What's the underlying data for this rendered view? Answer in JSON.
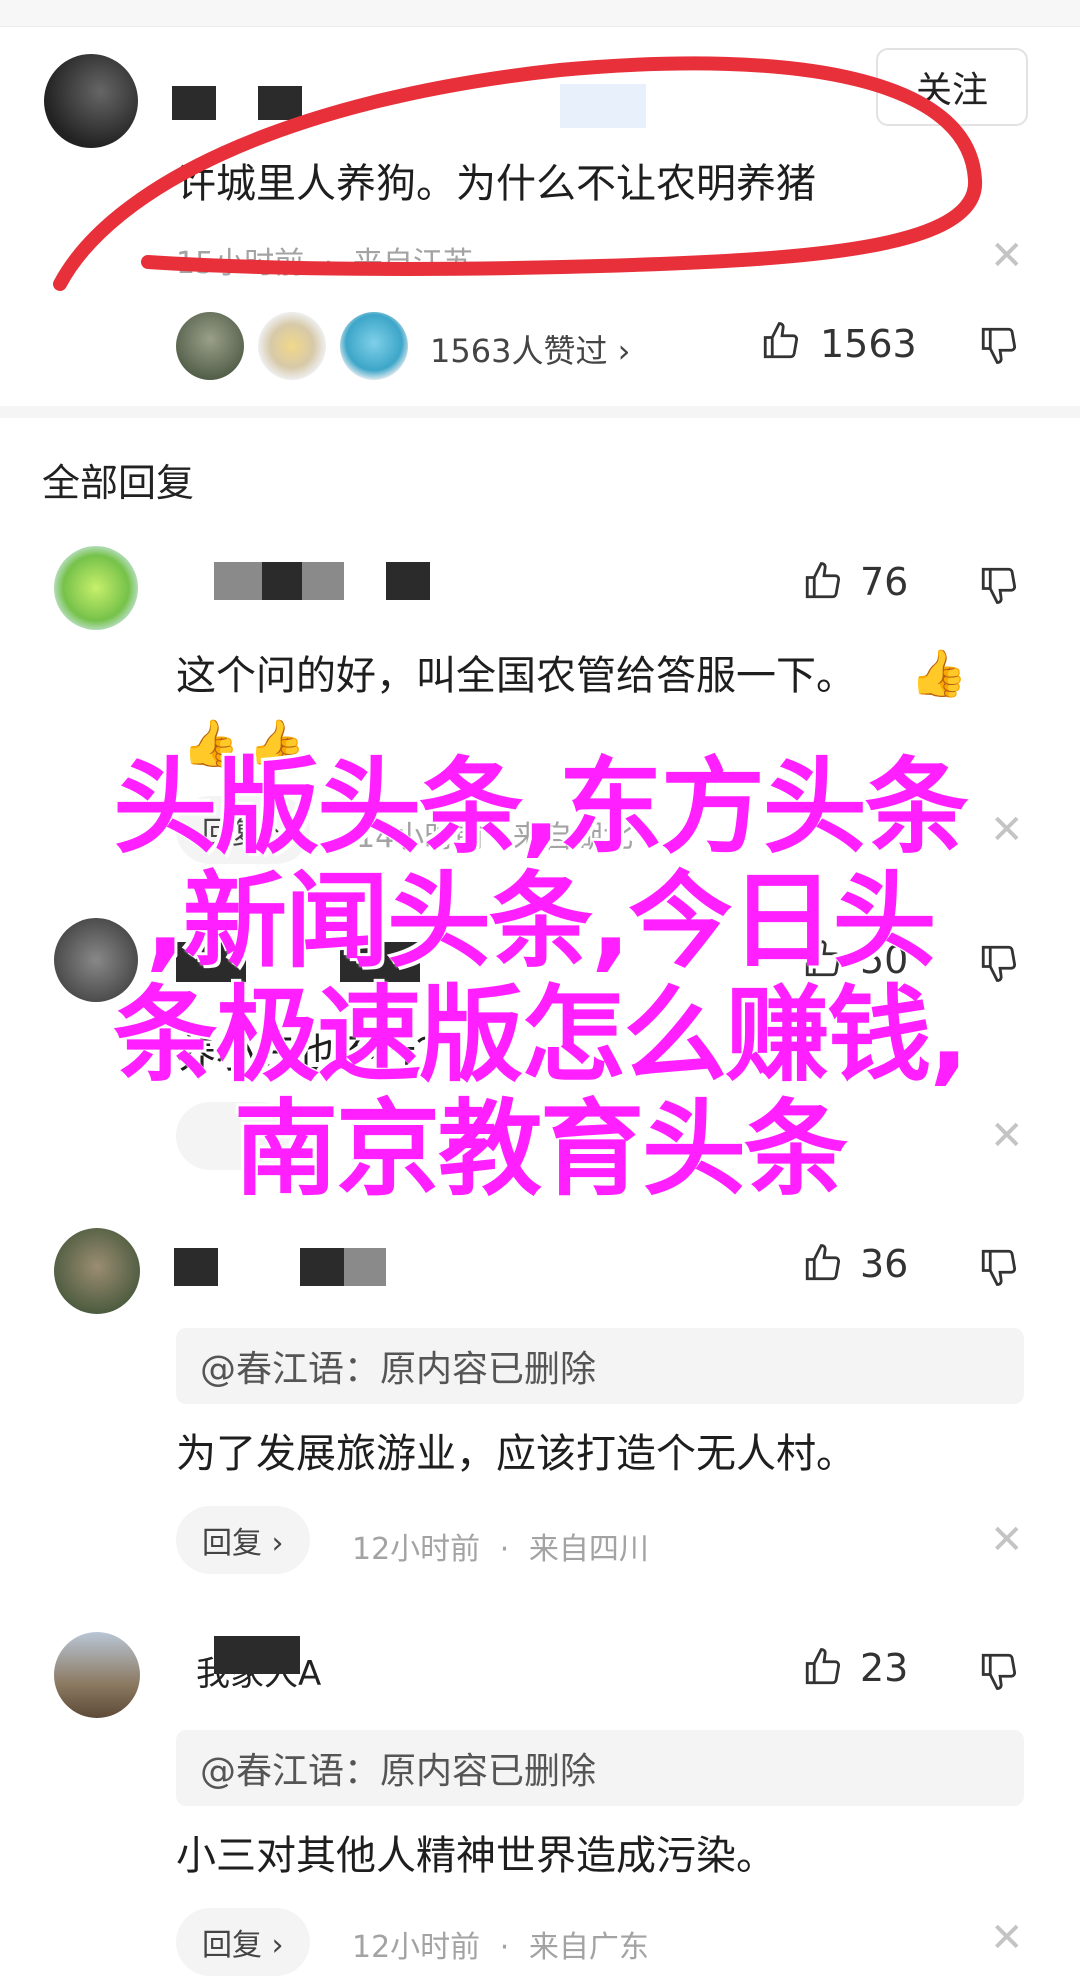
{
  "top_comment": {
    "follow_label": "关注",
    "text": "许城里人养狗。为什么不让农明养猪",
    "time": "15小时前",
    "separator": "·",
    "location": "来自江苏",
    "likers_text": "1563人赞过 ›",
    "like_count": "1563"
  },
  "section_title": "全部回复",
  "comments": [
    {
      "like_count": "76",
      "text": "这个问的好，叫全国农管给答服一下。",
      "reply_label": "回复 ›",
      "meta_visible": "14小时前 · 来自湖北"
    },
    {
      "like_count": "50",
      "text": "养小三也不行？"
    },
    {
      "like_count": "36",
      "quote": "@春江语：原内容已删除",
      "text": "为了发展旅游业，应该打造个无人村。",
      "reply_label": "回复 ›",
      "time": "12小时前",
      "separator": "·",
      "location": "来自四川"
    },
    {
      "author": "我家人A",
      "like_count": "23",
      "quote": "@春江语：原内容已删除",
      "text": "小三对其他人精神世界造成污染。",
      "reply_label": "回复 ›",
      "time": "12小时前",
      "separator": "·",
      "location": "来自广东"
    }
  ],
  "close_symbol": "✕",
  "watermark": {
    "line1": "头版头条,东方头条",
    "line2": ",新闻头条,今日头",
    "line3": "条极速版怎么赚钱,",
    "line4": "南京教育头条"
  },
  "colors": {
    "watermark": "#ff1fff",
    "annotation_stroke": "#e8303a",
    "meta_gray": "#a3a3a3"
  },
  "icons": [
    "thumbs-up-icon",
    "thumbs-down-icon",
    "close-icon",
    "thumbs-up-emoji"
  ]
}
